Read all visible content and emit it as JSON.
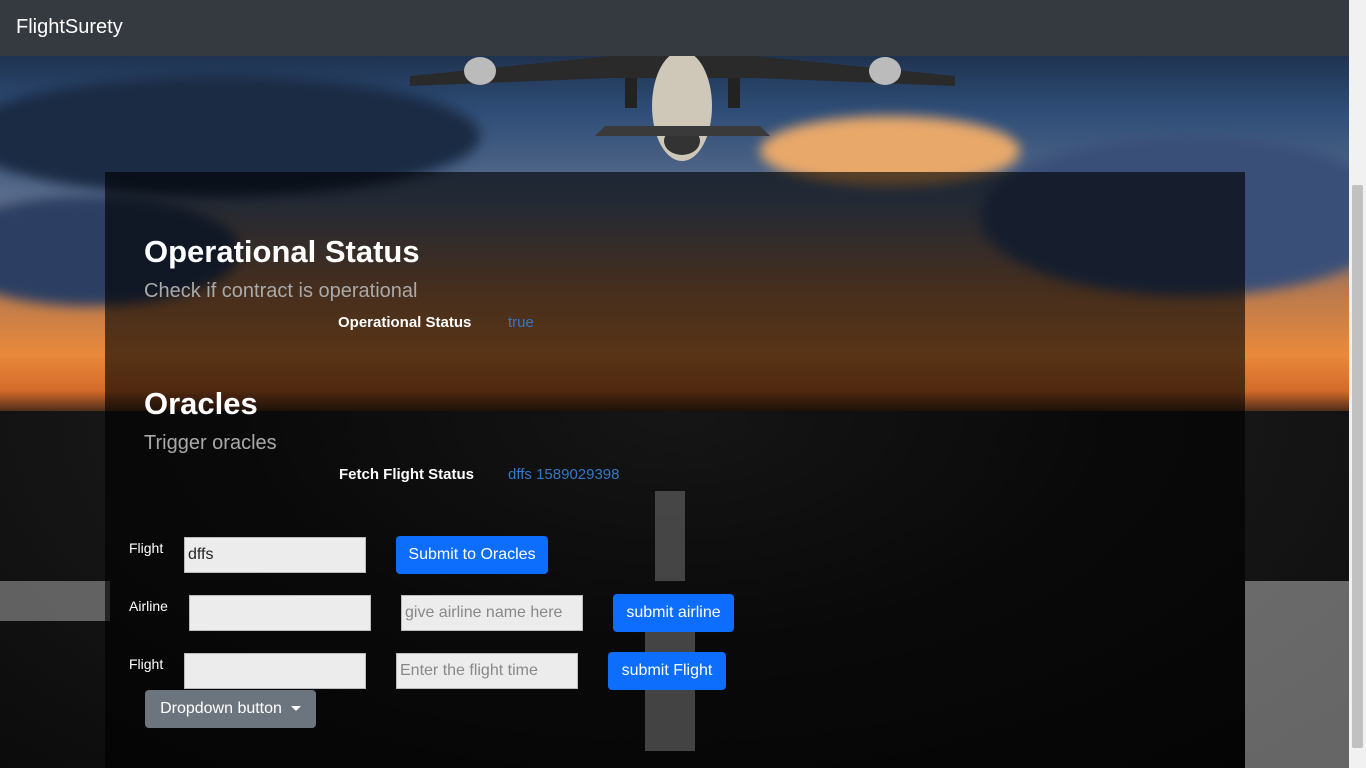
{
  "navbar": {
    "brand": "FlightSurety"
  },
  "operational": {
    "title": "Operational Status",
    "subtitle": "Check if contract is operational",
    "label": "Operational Status",
    "value": "true"
  },
  "oracles": {
    "title": "Oracles",
    "subtitle": "Trigger oracles",
    "label": "Fetch Flight Status",
    "value": "dffs 1589029398"
  },
  "form": {
    "flight_label": "Flight",
    "flight_value": "dffs",
    "submit_oracles": "Submit to Oracles",
    "airline_label": "Airline",
    "airline_address_value": "",
    "airline_name_placeholder": "give airline name here",
    "submit_airline": "submit airline",
    "flight2_label": "Flight",
    "flight2_value": "",
    "flight_time_placeholder": "Enter the flight time",
    "submit_flight": "submit Flight",
    "dropdown_label": "Dropdown button"
  },
  "colors": {
    "navbar": "#343a40",
    "primary": "#0d6efd",
    "link": "#3478c6",
    "secondary": "#6c757d"
  }
}
